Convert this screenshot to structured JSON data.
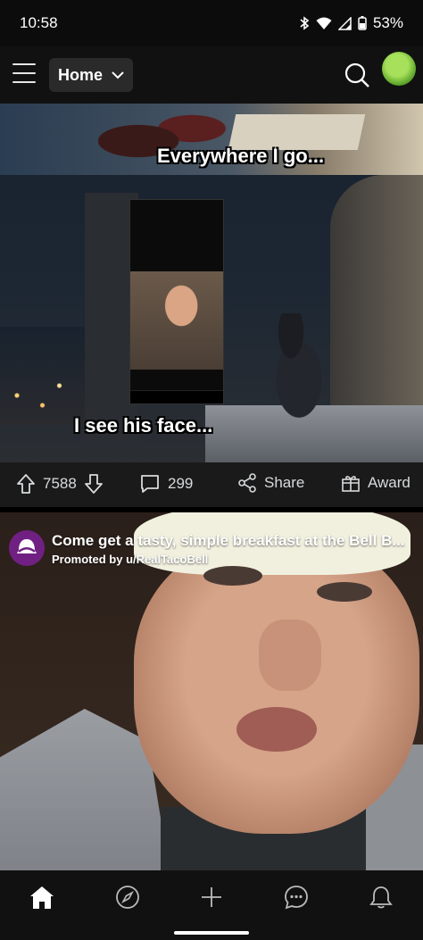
{
  "status": {
    "time": "10:58",
    "battery": "53%"
  },
  "header": {
    "feed_label": "Home"
  },
  "post": {
    "caption_top": "Everywhere I go...",
    "caption_bottom": "I see his face...",
    "votes": "7588",
    "comments": "299",
    "share_label": "Share",
    "award_label": "Award"
  },
  "promo": {
    "title": "Come get a tasty, simple breakfast at the Bell B...",
    "promoted_by": "Promoted by u/RealTacoBell"
  },
  "colors": {
    "accent_avatar": "#7bc23a",
    "taco_purple": "#702082"
  },
  "nav": {
    "items": [
      "home-icon",
      "explore-icon",
      "create-icon",
      "chat-icon",
      "notifications-icon"
    ]
  }
}
